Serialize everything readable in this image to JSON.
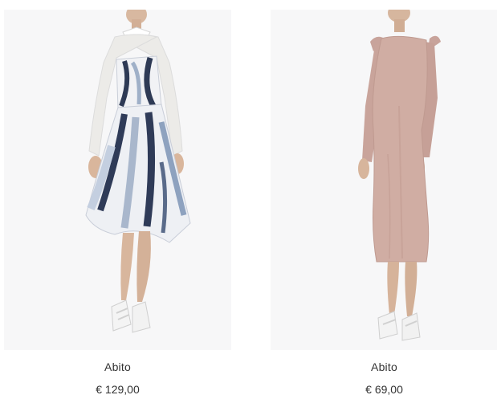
{
  "products": [
    {
      "name": "Abito",
      "price": "€ 129,00",
      "image": "model-white-blue-print-dress"
    },
    {
      "name": "Abito",
      "price": "€ 69,00",
      "image": "model-pink-knit-midi-dress"
    }
  ],
  "colors": {
    "photo_background": "#f7f7f8",
    "text": "#333333"
  }
}
